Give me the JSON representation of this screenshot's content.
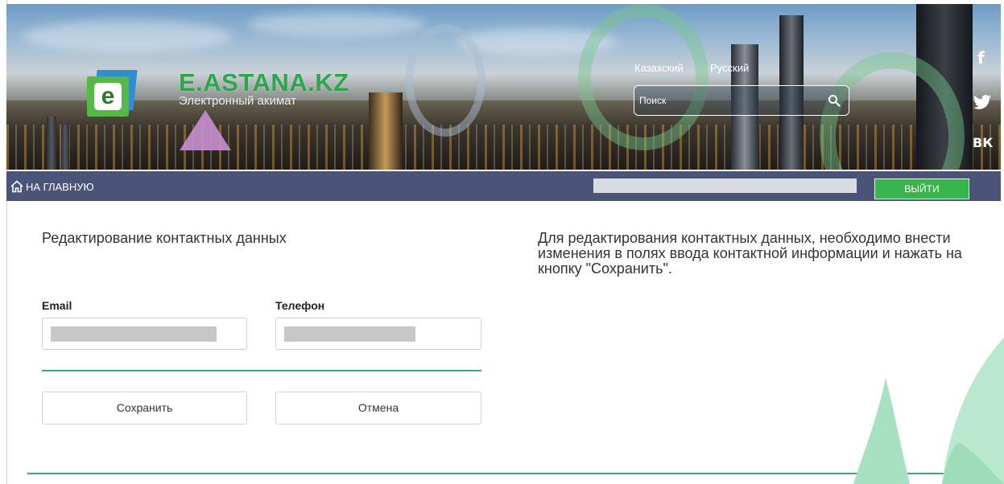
{
  "header": {
    "brand": "E.ASTANA.KZ",
    "tagline": "Электронный акимат",
    "languages": [
      "Казахский",
      "Русский"
    ],
    "search_placeholder": "Поиск",
    "social": [
      "f",
      "twitter-icon",
      "vk-icon"
    ],
    "colors": {
      "brand_green": "#2ea44f",
      "logo_blue": "#2f8fd0"
    }
  },
  "navbar": {
    "home_label": "НА ГЛАВНУЮ",
    "logout_label": "ВЫЙТИ",
    "colors": {
      "bar": "#4a5478",
      "logout": "#37b54a"
    }
  },
  "form": {
    "title": "Редактирование контактных данных",
    "email_label": "Email",
    "phone_label": "Телефон",
    "save_label": "Сохранить",
    "cancel_label": "Отмена"
  },
  "info": {
    "text": "Для редактирования контактных данных, необходимо внести изменения в полях ввода контактной информации и нажать на кнопку \"Сохранить\"."
  },
  "accent_color": "#3aa878"
}
